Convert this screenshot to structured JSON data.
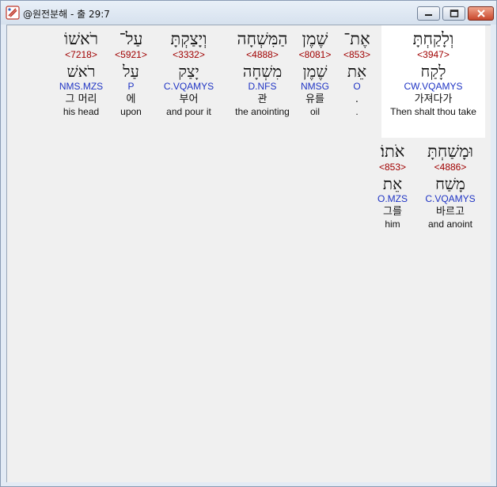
{
  "window": {
    "title": "@원전분해 - 출 29:7",
    "colors": {
      "strong": "#a00000",
      "morph": "#1f34c4",
      "selection": "#ffffff"
    }
  },
  "lines": [
    [
      {
        "hebrew": "רֹאשׁוֹ",
        "strong": "<7218>",
        "root": "רֹאשׁ",
        "morph": "NMS.MZS",
        "korean": "그 머리",
        "english": "his head"
      },
      {
        "hebrew": "עַל־",
        "strong": "<5921>",
        "root": "עַל",
        "morph": "P",
        "korean": "에",
        "english": "upon"
      },
      {
        "hebrew": "וְיָצַקְתָּ",
        "strong": "<3332>",
        "root": "יָצַק",
        "morph": "C.VQAMYS",
        "korean": "부어",
        "english": "and pour it"
      },
      {
        "hebrew": "הַמִּשְׁחָה",
        "strong": "<4888>",
        "root": "מִשְׁחָה",
        "morph": "D.NFS",
        "korean": "관",
        "english": "the anointing"
      },
      {
        "hebrew": "שֶׁמֶן",
        "strong": "<8081>",
        "root": "שֶׁמֶן",
        "morph": "NMSG",
        "korean": "유를",
        "english": "oil"
      },
      {
        "hebrew": "אֶת־",
        "strong": "<853>",
        "root": "אֵת",
        "morph": "O",
        "korean": ".",
        "english": "."
      },
      {
        "hebrew": "וְלָקַחְתָּ",
        "strong": "<3947>",
        "root": "לָקַח",
        "morph": "CW.VQAMYS",
        "korean": "가져다가",
        "english": "Then shalt thou take"
      }
    ],
    [
      {
        "hebrew": "אֹתוֹ׃",
        "strong": "<853>",
        "root": "אֵת",
        "morph": "O.MZS",
        "korean": "그를",
        "english": "him"
      },
      {
        "hebrew": "וּמָשַׁחְתָּ",
        "strong": "<4886>",
        "root": "מָשַׁח",
        "morph": "C.VQAMYS",
        "korean": "바르고",
        "english": "and anoint"
      }
    ]
  ]
}
